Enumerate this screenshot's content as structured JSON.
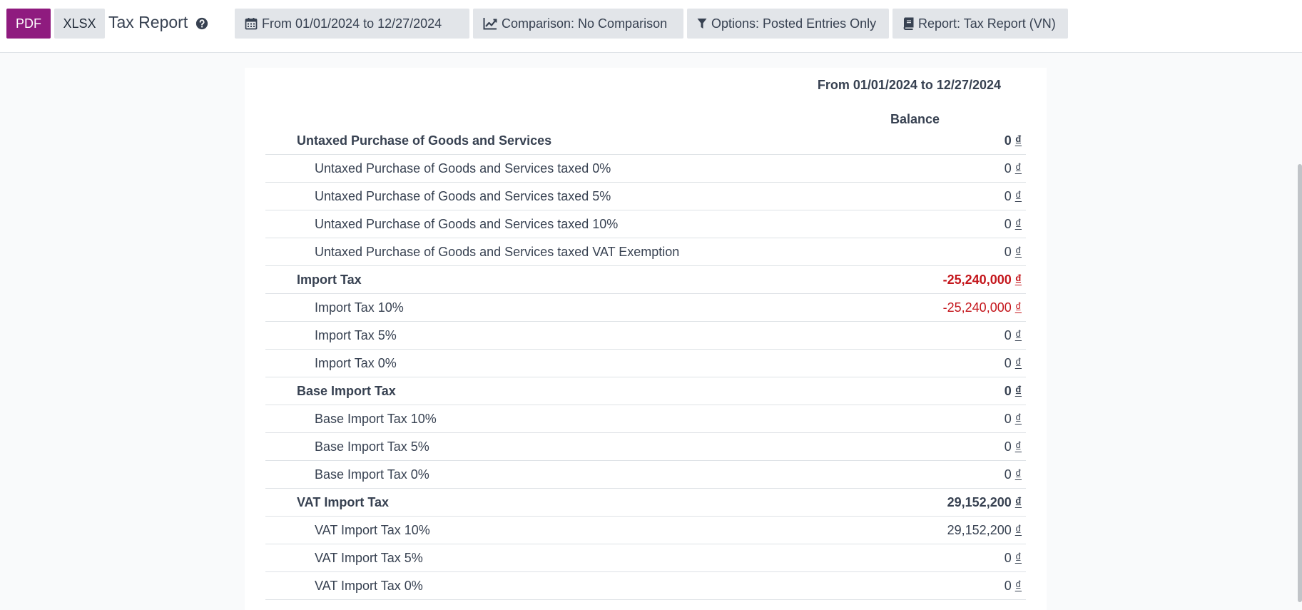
{
  "toolbar": {
    "pdf_label": "PDF",
    "xlsx_label": "XLSX",
    "title": "Tax Report",
    "filters": {
      "date": "From 01/01/2024 to 12/27/2024",
      "comparison": "Comparison: No Comparison",
      "options": "Options: Posted Entries Only",
      "report": "Report: Tax Report (VN)"
    }
  },
  "report": {
    "period_header": "From 01/01/2024 to 12/27/2024",
    "column_label": "Balance",
    "currency_symbol": "₫",
    "lines": [
      {
        "label": "Untaxed Purchase of Goods and Services",
        "amount": "0",
        "level": "section",
        "negative": false
      },
      {
        "label": "Untaxed Purchase of Goods and Services taxed 0%",
        "amount": "0",
        "level": "child",
        "negative": false
      },
      {
        "label": "Untaxed Purchase of Goods and Services taxed 5%",
        "amount": "0",
        "level": "child",
        "negative": false
      },
      {
        "label": "Untaxed Purchase of Goods and Services taxed 10%",
        "amount": "0",
        "level": "child",
        "negative": false
      },
      {
        "label": "Untaxed Purchase of Goods and Services taxed VAT Exemption",
        "amount": "0",
        "level": "child",
        "negative": false
      },
      {
        "label": "Import Tax",
        "amount": "-25,240,000",
        "level": "section",
        "negative": true
      },
      {
        "label": "Import Tax 10%",
        "amount": "-25,240,000",
        "level": "child",
        "negative": true
      },
      {
        "label": "Import Tax 5%",
        "amount": "0",
        "level": "child",
        "negative": false
      },
      {
        "label": "Import Tax 0%",
        "amount": "0",
        "level": "child",
        "negative": false
      },
      {
        "label": "Base Import Tax",
        "amount": "0",
        "level": "section",
        "negative": false
      },
      {
        "label": "Base Import Tax 10%",
        "amount": "0",
        "level": "child",
        "negative": false
      },
      {
        "label": "Base Import Tax 5%",
        "amount": "0",
        "level": "child",
        "negative": false
      },
      {
        "label": "Base Import Tax 0%",
        "amount": "0",
        "level": "child",
        "negative": false
      },
      {
        "label": "VAT Import Tax",
        "amount": "29,152,200",
        "level": "section",
        "negative": false
      },
      {
        "label": "VAT Import Tax 10%",
        "amount": "29,152,200",
        "level": "child",
        "negative": false
      },
      {
        "label": "VAT Import Tax 5%",
        "amount": "0",
        "level": "child",
        "negative": false
      },
      {
        "label": "VAT Import Tax 0%",
        "amount": "0",
        "level": "child",
        "negative": false
      }
    ]
  },
  "colors": {
    "brand": "#8f1b7f",
    "negative": "#c4161c",
    "button_bg": "#e2e5e9"
  },
  "icons": {
    "help": "question-circle-icon",
    "date": "calendar-icon",
    "comparison": "line-chart-icon",
    "options": "filter-icon",
    "report": "book-icon"
  }
}
